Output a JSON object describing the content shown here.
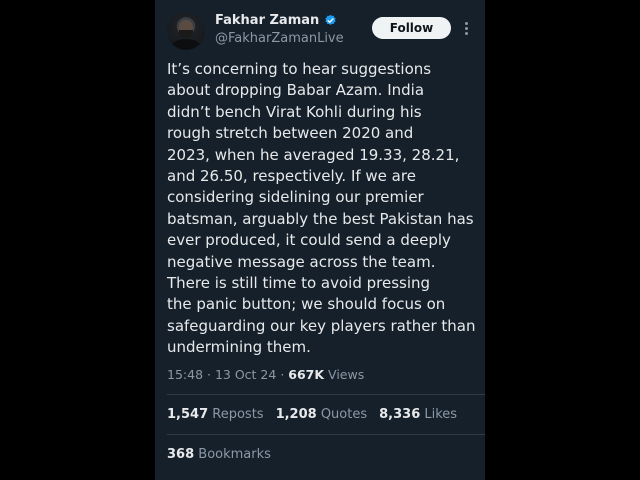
{
  "author": {
    "name": "Fakhar Zaman",
    "handle": "@FakharZamanLive",
    "verified": true
  },
  "follow_label": "Follow",
  "more_icon": "more-vertical-icon",
  "tweet_lines": [
    "It’s concerning to hear suggestions",
    "about dropping Babar Azam. India",
    "didn’t bench Virat Kohli during his",
    "rough stretch between 2020 and",
    "2023, when he averaged 19.33, 28.21,",
    "and 26.50, respectively. If we are",
    "considering sidelining our premier",
    "batsman, arguably the best Pakistan has",
    "ever produced, it could send a deeply",
    "negative message across the team.",
    "There is still time to avoid pressing",
    "the panic button; we should focus on",
    "safeguarding our key players rather than",
    "undermining them."
  ],
  "meta": {
    "time": "15:48",
    "date": "13 Oct 24",
    "views_count": "667K",
    "views_label": "Views"
  },
  "stats": {
    "reposts_count": "1,547",
    "reposts_label": "Reposts",
    "quotes_count": "1,208",
    "quotes_label": "Quotes",
    "likes_count": "8,336",
    "likes_label": "Likes"
  },
  "bookmarks": {
    "count": "368",
    "label": "Bookmarks"
  },
  "colors": {
    "card_bg": "#15202b",
    "text": "#e7e9ea",
    "muted": "#8b98a5",
    "verified": "#1d9bf0",
    "follow_bg": "#eff3f4"
  }
}
